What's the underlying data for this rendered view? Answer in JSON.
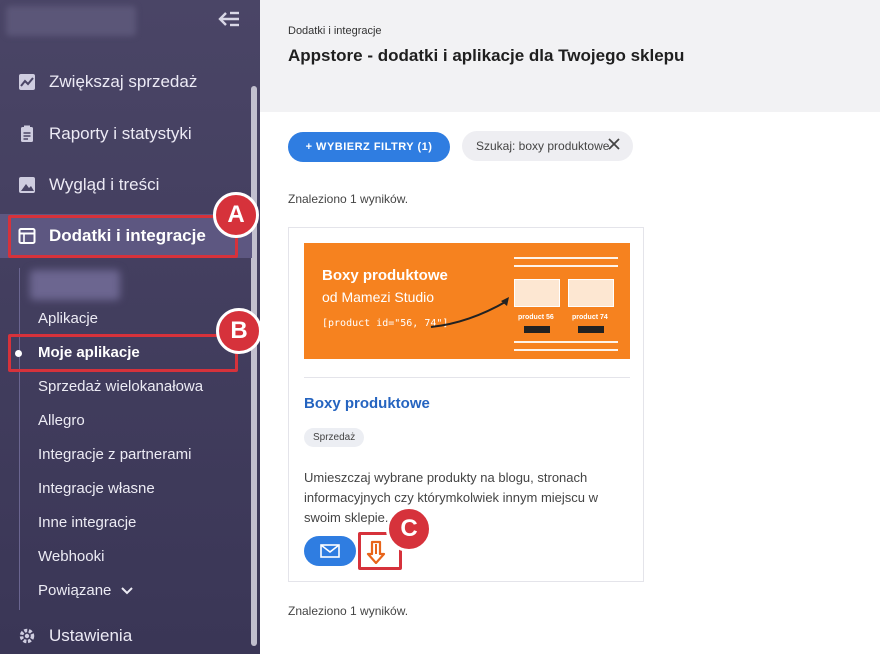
{
  "sidebar": {
    "collapse_icon": "collapse-left-icon",
    "items": [
      {
        "label": "Zwiększaj sprzedaż",
        "icon": "chart-icon"
      },
      {
        "label": "Raporty i statystyki",
        "icon": "clipboard-icon"
      },
      {
        "label": "Wygląd i treści",
        "icon": "image-icon"
      },
      {
        "label": "Dodatki i integracje",
        "icon": "window-icon"
      },
      {
        "label": "Ustawienia",
        "icon": "gear-icon"
      }
    ],
    "subitems": [
      {
        "label": "Aplikacje"
      },
      {
        "label": "Moje aplikacje"
      },
      {
        "label": "Sprzedaż wielokanałowa"
      },
      {
        "label": "Allegro"
      },
      {
        "label": "Integracje z partnerami"
      },
      {
        "label": "Integracje własne"
      },
      {
        "label": "Inne integracje"
      },
      {
        "label": "Webhooki"
      },
      {
        "label": "Powiązane"
      }
    ]
  },
  "header": {
    "breadcrumb": "Dodatki i integracje",
    "title": "Appstore - dodatki i aplikacje dla Twojego sklepu"
  },
  "filters": {
    "filter_button": "+ WYBIERZ FILTRY (1)",
    "search_chip": "Szukaj: boxy produktowe"
  },
  "results_text": "Znaleziono 1 wyników.",
  "card": {
    "banner": {
      "line1": "Boxy produktowe",
      "line2": "od Mamezi Studio",
      "code": "[product id=\"56, 74\"]",
      "product1": "product 56",
      "product2": "product 74"
    },
    "title": "Boxy produktowe",
    "tag": "Sprzedaż",
    "description": "Umieszczaj wybrane produkty na blogu, stronach informacyjnych czy którymkolwiek innym miejscu w swoim sklepie."
  },
  "annotations": {
    "a": "A",
    "b": "B",
    "c": "C",
    "color": "#d6323b"
  }
}
